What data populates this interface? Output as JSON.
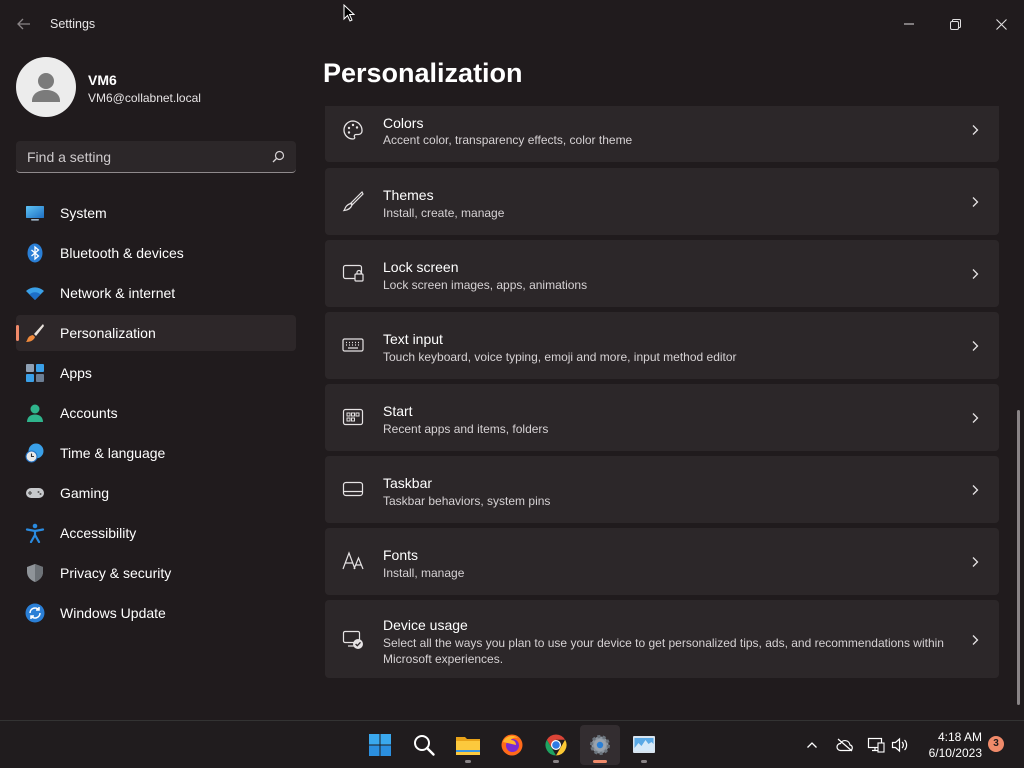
{
  "window": {
    "title": "Settings",
    "back_icon": "arrow-left-icon",
    "minimize_icon": "minimize-icon",
    "maximize_icon": "restore-icon",
    "close_icon": "close-icon"
  },
  "profile": {
    "name": "VM6",
    "email": "VM6@collabnet.local"
  },
  "search": {
    "placeholder": "Find a setting"
  },
  "sidebar": {
    "items": [
      {
        "label": "System",
        "icon": "monitor-icon"
      },
      {
        "label": "Bluetooth & devices",
        "icon": "bluetooth-icon"
      },
      {
        "label": "Network & internet",
        "icon": "wifi-icon"
      },
      {
        "label": "Personalization",
        "icon": "paintbrush-icon",
        "selected": true
      },
      {
        "label": "Apps",
        "icon": "apps-icon"
      },
      {
        "label": "Accounts",
        "icon": "person-icon"
      },
      {
        "label": "Time & language",
        "icon": "globe-clock-icon"
      },
      {
        "label": "Gaming",
        "icon": "gamepad-icon"
      },
      {
        "label": "Accessibility",
        "icon": "accessibility-icon"
      },
      {
        "label": "Privacy & security",
        "icon": "shield-icon"
      },
      {
        "label": "Windows Update",
        "icon": "update-icon"
      }
    ]
  },
  "main": {
    "title": "Personalization",
    "cards": [
      {
        "title": "Colors",
        "desc": "Accent color, transparency effects, color theme",
        "icon": "palette-icon"
      },
      {
        "title": "Themes",
        "desc": "Install, create, manage",
        "icon": "brush-icon"
      },
      {
        "title": "Lock screen",
        "desc": "Lock screen images, apps, animations",
        "icon": "lock-screen-icon"
      },
      {
        "title": "Text input",
        "desc": "Touch keyboard, voice typing, emoji and more, input method editor",
        "icon": "keyboard-icon"
      },
      {
        "title": "Start",
        "desc": "Recent apps and items, folders",
        "icon": "start-icon"
      },
      {
        "title": "Taskbar",
        "desc": "Taskbar behaviors, system pins",
        "icon": "taskbar-icon"
      },
      {
        "title": "Fonts",
        "desc": "Install, manage",
        "icon": "fonts-icon"
      },
      {
        "title": "Device usage",
        "desc": "Select all the ways you plan to use your device to get personalized tips, ads, and recommendations within Microsoft experiences.",
        "icon": "device-usage-icon"
      }
    ]
  },
  "taskbar": {
    "apps": [
      "windows-start-icon",
      "search-icon",
      "file-explorer-icon",
      "firefox-icon",
      "chrome-icon",
      "settings-gear-icon",
      "task-manager-icon"
    ],
    "time": "4:18 AM",
    "date": "6/10/2023",
    "notifications": "3"
  },
  "colors": {
    "accent": "#f08a6a",
    "background": "#201b1d",
    "card": "#2c2729"
  }
}
